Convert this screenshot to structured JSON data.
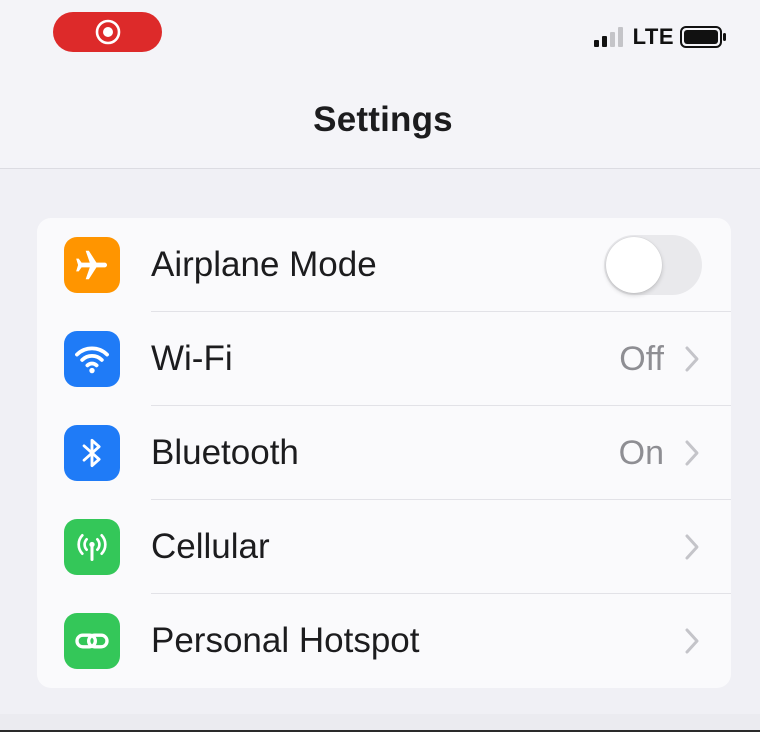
{
  "status_bar": {
    "network_label": "LTE",
    "recording_icon": "screen-record-icon",
    "signal_icon": "cellular-signal-icon",
    "battery_icon": "battery-icon"
  },
  "header": {
    "title": "Settings"
  },
  "settings": {
    "items": [
      {
        "key": "airplane",
        "label": "Airplane Mode",
        "icon": "airplane-icon",
        "icon_color": "#ff9500",
        "control": "toggle",
        "toggle_on": false,
        "value": ""
      },
      {
        "key": "wifi",
        "label": "Wi-Fi",
        "icon": "wifi-icon",
        "icon_color": "#1f7bf7",
        "control": "disclosure",
        "value": "Off"
      },
      {
        "key": "bluetooth",
        "label": "Bluetooth",
        "icon": "bluetooth-icon",
        "icon_color": "#1f7bf7",
        "control": "disclosure",
        "value": "On"
      },
      {
        "key": "cellular",
        "label": "Cellular",
        "icon": "cellular-antenna-icon",
        "icon_color": "#34c759",
        "control": "disclosure",
        "value": ""
      },
      {
        "key": "hotspot",
        "label": "Personal Hotspot",
        "icon": "hotspot-link-icon",
        "icon_color": "#34c759",
        "control": "disclosure",
        "value": ""
      }
    ]
  },
  "colors": {
    "recording_red": "#dd2a2a",
    "orange": "#ff9500",
    "blue": "#1f7bf7",
    "green": "#34c759",
    "secondary_text": "#8e8e93"
  }
}
